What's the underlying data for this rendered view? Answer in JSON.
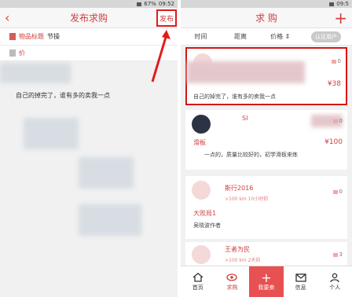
{
  "left_screen": {
    "status": {
      "time": "09:52",
      "battery": "67%"
    },
    "header": {
      "title": "发布求购",
      "publish_label": "发布"
    },
    "form": {
      "title_label": "物品标题",
      "title_value": "节操",
      "price_label": "价"
    },
    "description": "自己的掉完了，谁有多的卖我一点"
  },
  "right_screen": {
    "status": {
      "time": "09:5"
    },
    "header": {
      "title": "求  购",
      "add_label": "+"
    },
    "filters": [
      "时间",
      "距离",
      "价格 ⇕"
    ],
    "cert_label": "认证用户",
    "cards": [
      {
        "comments": "0",
        "price": "¥38",
        "text": "自己的掉完了，谁有多的卖我一点"
      },
      {
        "name": "SI",
        "comments": "0",
        "title": "滑板",
        "price": "¥100",
        "text": "一点的，质量比较好的，初学滑板来练"
      },
      {
        "name": "斯行2016",
        "meta": ">100 km  10小时前",
        "comments": "0",
        "title": "大败局1",
        "text": "吴晓波作者"
      },
      {
        "name": "王者为民",
        "meta": ">100 km  2天前",
        "comments": "3"
      }
    ],
    "tabs": [
      "首页",
      "求购",
      "我要卖",
      "信息",
      "个人"
    ]
  },
  "colors": {
    "accent": "#d23e3e",
    "highlight_box": "#e21b1b",
    "sell_tab": "#e85151"
  }
}
